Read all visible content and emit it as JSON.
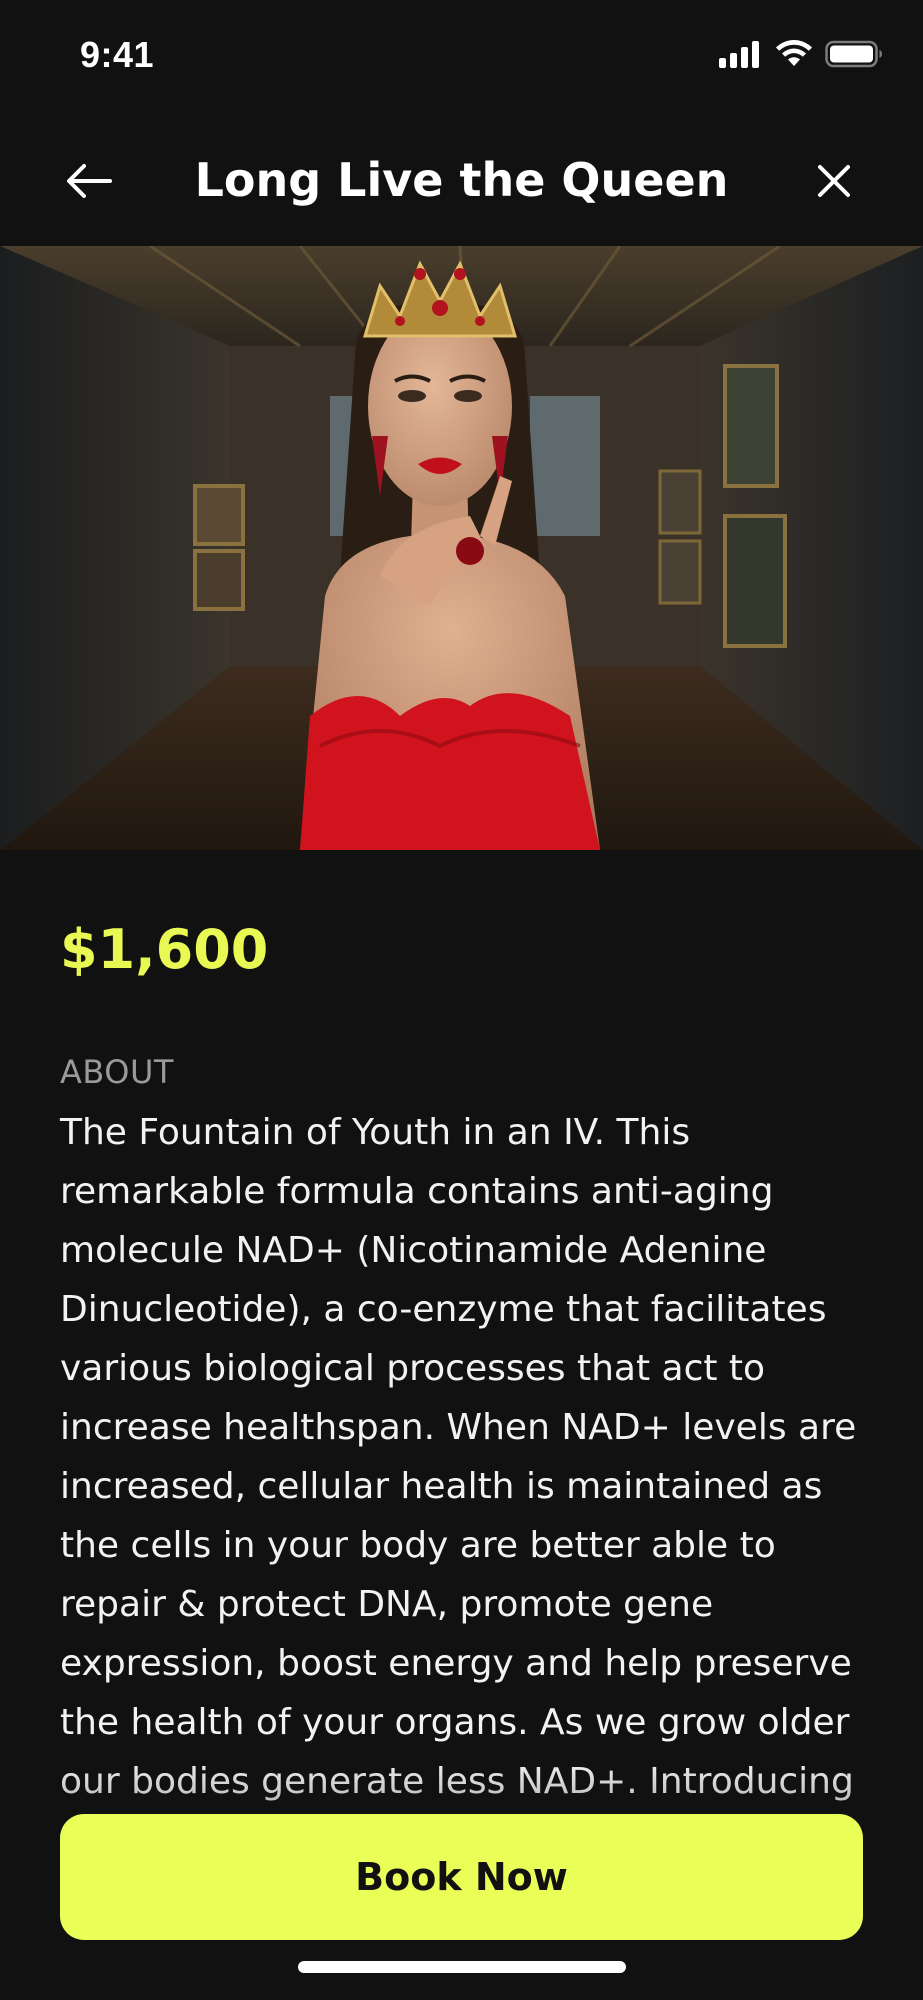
{
  "status_bar": {
    "time": "9:41",
    "icons": [
      "signal-icon",
      "wifi-icon",
      "battery-icon"
    ]
  },
  "header": {
    "title": "Long Live the Queen",
    "back_icon": "arrow-left-icon",
    "close_icon": "close-icon"
  },
  "hero": {
    "image_subject": "woman wearing a jeweled crown and red dress in an ornate room"
  },
  "product": {
    "price": "$1,600",
    "about_label": "ABOUT",
    "about_text": "The Fountain of Youth in an IV. This remarkable formula contains anti-aging molecule NAD+ (Nicotinamide Adenine Dinucleotide), a co-enzyme that facilitates various biological processes that act to increase healthspan. When NAD+ levels are increased, cellular health is maintained as the cells in your body are better able to repair & protect DNA, promote gene expression, boost energy and help preserve the health of your organs. As we grow older our bodies generate less NAD+. Introducing NAD+ supply and maintain a youthful"
  },
  "actions": {
    "book_now": "Book Now"
  },
  "colors": {
    "background": "#111111",
    "accent": "#e9fe57",
    "price": "#e9f853",
    "muted_label": "#9a9a9a"
  }
}
